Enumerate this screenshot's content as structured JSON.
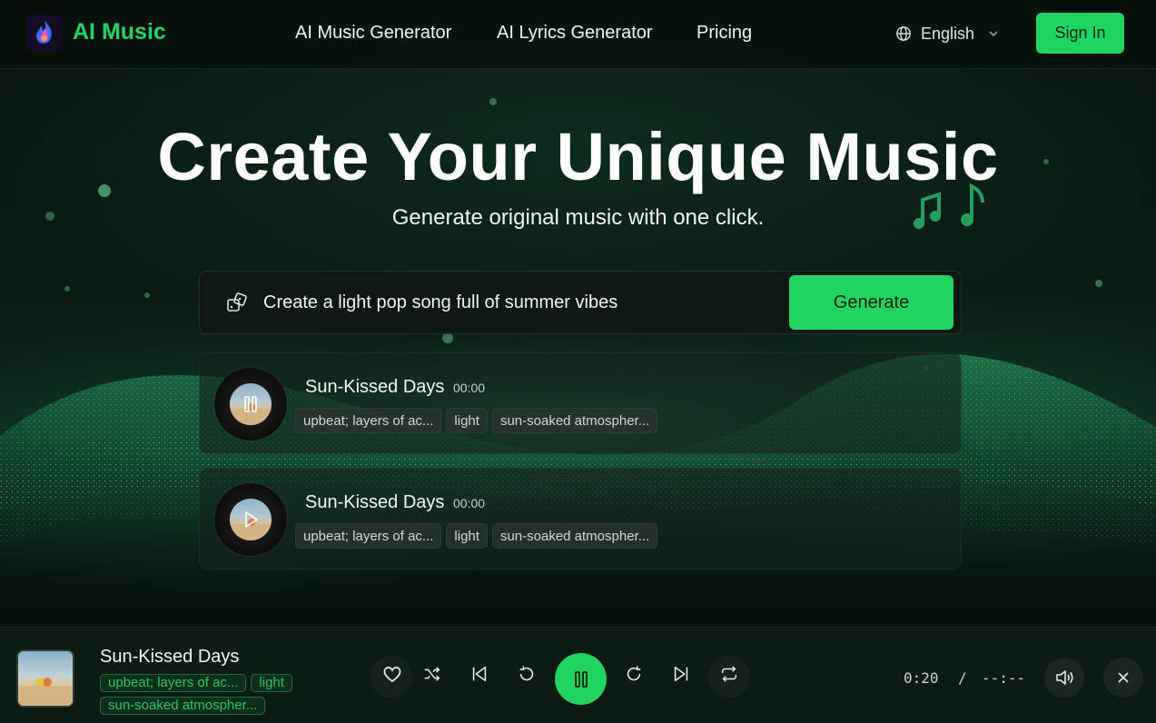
{
  "brand": {
    "name": "AI Music"
  },
  "nav": {
    "items": [
      {
        "label": "AI Music Generator"
      },
      {
        "label": "AI Lyrics Generator"
      },
      {
        "label": "Pricing"
      }
    ],
    "language": "English",
    "signin_label": "Sign In"
  },
  "hero": {
    "title": "Create Your Unique Music",
    "subtitle": "Generate original music with one click."
  },
  "prompt": {
    "text": "Create a light pop song full of summer vibes",
    "generate_label": "Generate"
  },
  "songs": [
    {
      "title": "Sun-Kissed Days",
      "time": "00:00",
      "state": "playing",
      "tags": [
        "upbeat; layers of ac...",
        "light",
        "sun-soaked atmospher..."
      ]
    },
    {
      "title": "Sun-Kissed Days",
      "time": "00:00",
      "state": "paused",
      "tags": [
        "upbeat; layers of ac...",
        "light",
        "sun-soaked atmospher..."
      ]
    }
  ],
  "player": {
    "title": "Sun-Kissed Days",
    "tags": [
      "upbeat; layers of ac...",
      "light",
      "sun-soaked atmospher..."
    ],
    "current_time": "0:20",
    "separator": "/",
    "duration": "--:--"
  },
  "colors": {
    "accent": "#1fd461",
    "background": "#050d09",
    "tag_text": "#25c964"
  }
}
